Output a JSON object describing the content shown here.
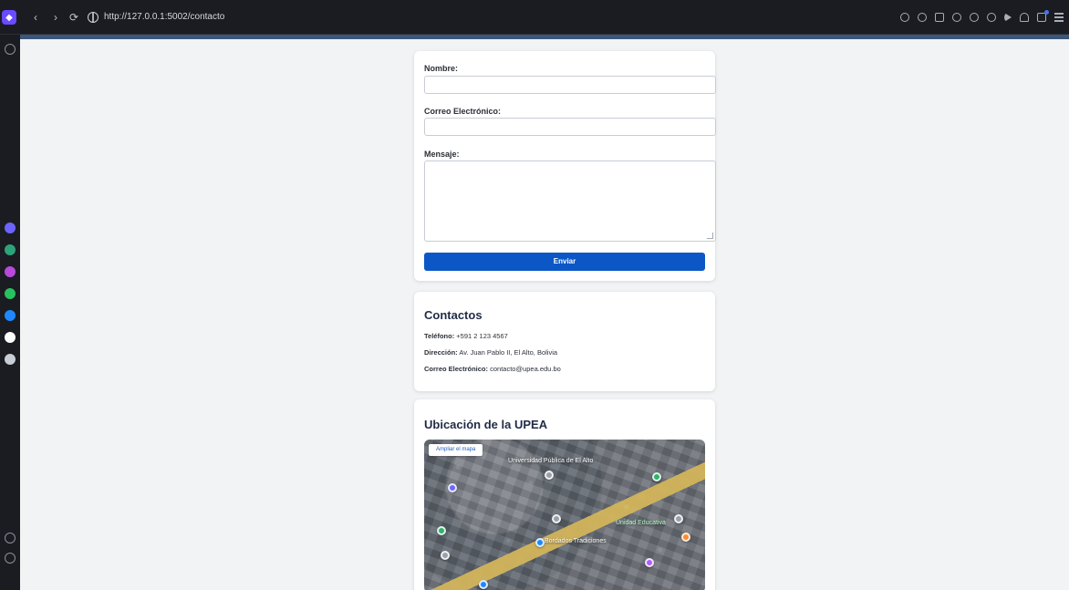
{
  "browser": {
    "url": "http://127.0.0.1:5002/contacto"
  },
  "form": {
    "name_label": "Nombre:",
    "email_label": "Correo Electrónico:",
    "message_label": "Mensaje:",
    "submit_label": "Enviar",
    "name_value": "",
    "email_value": "",
    "message_value": ""
  },
  "contacts": {
    "title": "Contactos",
    "phone_label": "Teléfono:",
    "phone_value": "+591 2 123 4567",
    "address_label": "Dirección:",
    "address_value": "Av. Juan Pablo II, El Alto, Bolivia",
    "email_label": "Correo Electrónico:",
    "email_value": "contacto@upea.edu.bo"
  },
  "map": {
    "title": "Ubicación de la UPEA",
    "expand_label": "Ampliar el mapa",
    "labels": [
      "Universidad Pública de El Alto",
      "Unidad Educativa",
      "Bordados Tradiciones"
    ]
  },
  "colors": {
    "primary_button": "#0b57c6",
    "heading": "#1f2b45",
    "page_bg": "#f2f3f5"
  },
  "icons": {
    "back": "chevron-left-icon",
    "forward": "chevron-right-icon",
    "reload": "reload-icon",
    "site": "globe-icon"
  }
}
